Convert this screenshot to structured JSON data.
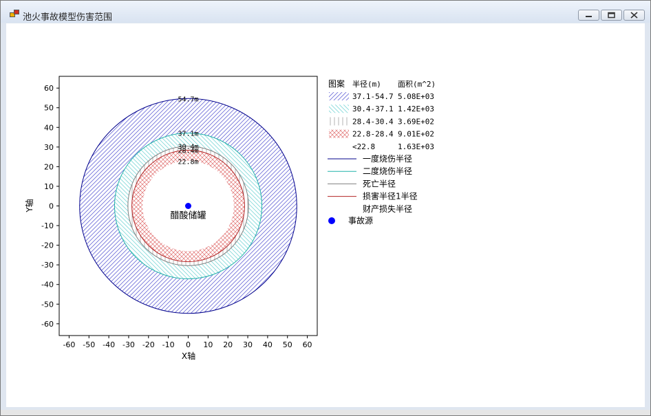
{
  "window": {
    "title": "池火事故模型伤害范围",
    "controls": {
      "minimize": "minimize-icon",
      "restore": "restore-icon",
      "close": "close-icon"
    }
  },
  "chart_data": {
    "type": "scatter",
    "xlabel": "X轴",
    "ylabel": "Y轴",
    "xlim": [
      -65,
      65
    ],
    "ylim": [
      -66,
      66
    ],
    "xticks": [
      -60,
      -50,
      -40,
      -30,
      -20,
      -10,
      0,
      10,
      20,
      30,
      40,
      50,
      60
    ],
    "yticks": [
      60,
      50,
      40,
      30,
      20,
      10,
      0,
      -10,
      -20,
      -30,
      -40,
      -50,
      -60
    ],
    "source": {
      "x": 0,
      "y": 0,
      "label": "醋酸储罐",
      "color": "#0000ff"
    },
    "rings": [
      {
        "name": "一度烧伤半径",
        "radius": 54.7,
        "label": "54.7m",
        "color": "#00008b",
        "band": [
          37.1,
          54.7
        ],
        "hatch": "diagonal",
        "hatch_color": "#6a6ad8"
      },
      {
        "name": "二度烧伤半径",
        "radius": 37.1,
        "label": "37.1m",
        "color": "#20b2aa",
        "band": [
          30.4,
          37.1
        ],
        "hatch": "backdiagonal",
        "hatch_color": "#7fd8d8"
      },
      {
        "name": "死亡半径",
        "radius": 30.4,
        "label": "30.4m",
        "color": "#808080",
        "band": [
          28.4,
          30.4
        ],
        "hatch": "vertical",
        "hatch_color": "#a0a0a0"
      },
      {
        "name": "损害半径1半径",
        "radius": 28.4,
        "label": "28.4m",
        "color": "#b22222",
        "band": [
          22.8,
          28.4
        ],
        "hatch": "cross",
        "hatch_color": "#e07070"
      },
      {
        "name": "财产损失半径",
        "radius": 22.8,
        "label": "22.8m",
        "color": "#ffffff",
        "band": [
          0,
          22.8
        ],
        "hatch": "none",
        "hatch_color": "#ffffff"
      }
    ],
    "legend": {
      "placement": "right",
      "header": {
        "pattern": "图案",
        "radius": "半径(m)",
        "area": "面积(m^2)"
      },
      "area_rows": [
        {
          "range": "37.1-54.7",
          "area": "5.08E+03",
          "hatch": "diagonal"
        },
        {
          "range": "30.4-37.1",
          "area": "1.42E+03",
          "hatch": "backdiagonal"
        },
        {
          "range": "28.4-30.4",
          "area": "3.69E+02",
          "hatch": "vertical"
        },
        {
          "range": "22.8-28.4",
          "area": "9.01E+02",
          "hatch": "cross"
        },
        {
          "range": "<22.8",
          "area": "1.63E+03",
          "hatch": "none"
        }
      ],
      "line_rows": [
        {
          "label": "一度烧伤半径",
          "color": "#00008b"
        },
        {
          "label": "二度烧伤半径",
          "color": "#20b2aa"
        },
        {
          "label": "死亡半径",
          "color": "#808080"
        },
        {
          "label": "损害半径1半径",
          "color": "#b22222"
        },
        {
          "label": "财产损失半径",
          "color": "#ffffff"
        }
      ],
      "marker_row": {
        "label": "事故源",
        "color": "#0000ff"
      }
    }
  }
}
